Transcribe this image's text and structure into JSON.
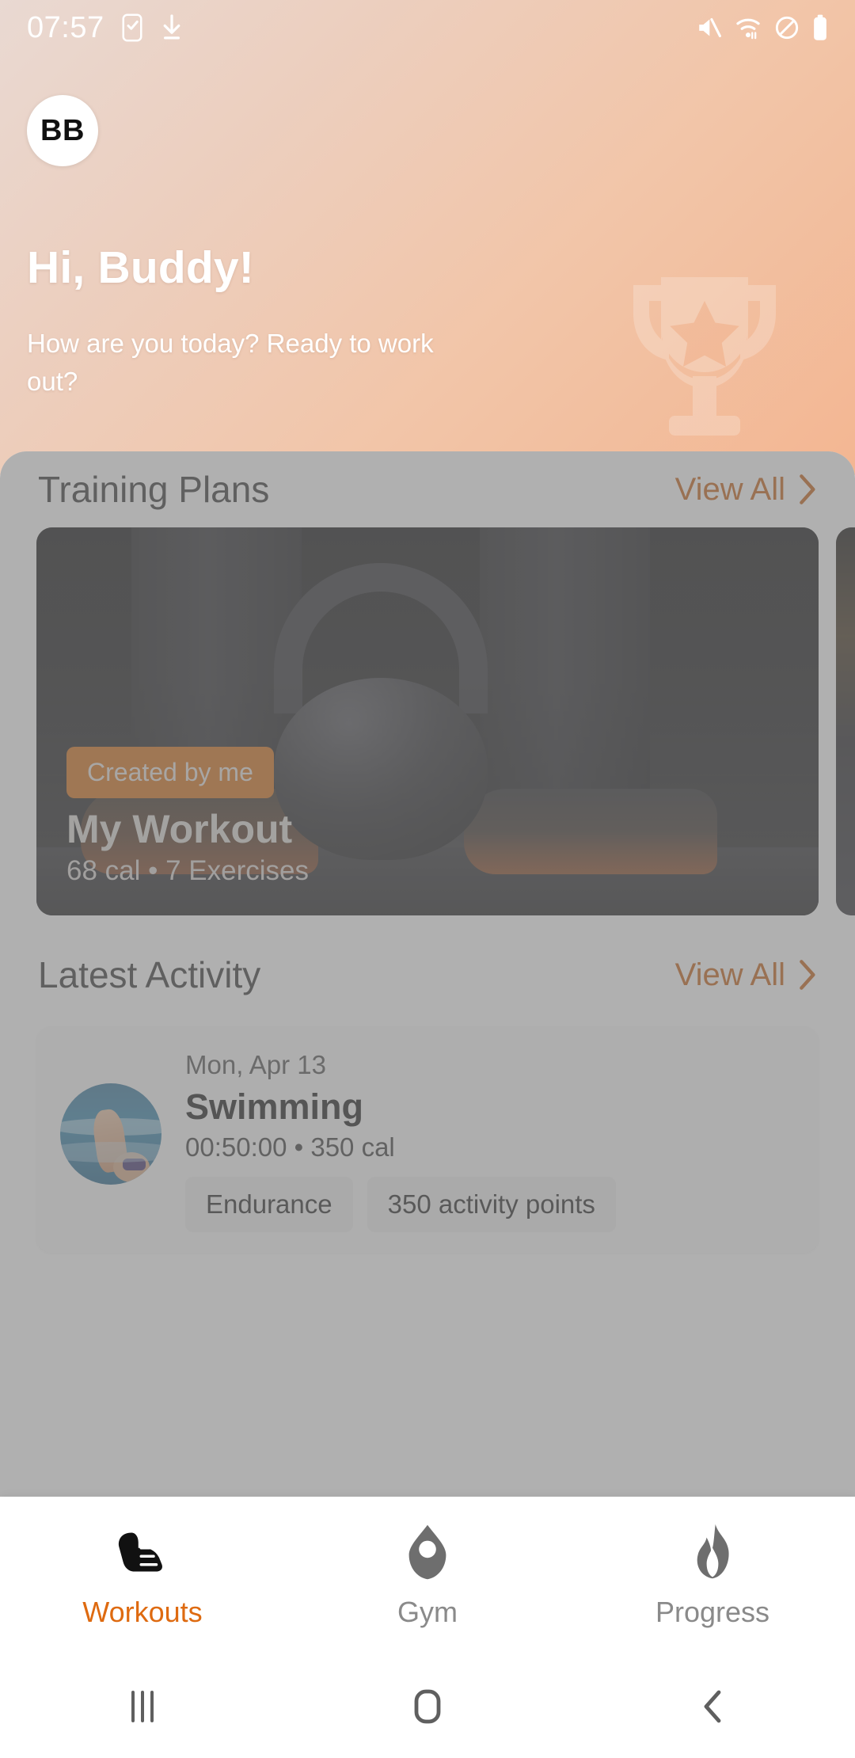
{
  "status_bar": {
    "time": "07:57",
    "left_icons": [
      "note-checklist-icon",
      "download-icon"
    ],
    "right_icons": [
      "mute-icon",
      "wifi-icon",
      "do-not-disturb-icon",
      "battery-icon"
    ]
  },
  "header": {
    "avatar_initials": "BB",
    "greeting": "Hi, Buddy!",
    "subgreeting": "How are you today? Ready to work out?",
    "watermark_icon": "trophy-icon",
    "gradient_from": "#e9d9d2",
    "gradient_to": "#f3b692"
  },
  "training_plans": {
    "section_title": "Training Plans",
    "view_all_label": "View All",
    "cards": [
      {
        "badge": "Created by me",
        "title": "My Workout",
        "subtitle": "68 cal • 7 Exercises",
        "image_alt": "kettlebell-photo"
      },
      {
        "badge": "",
        "title": "",
        "subtitle": "",
        "image_alt": "gym-photo"
      }
    ]
  },
  "latest_activity": {
    "section_title": "Latest Activity",
    "view_all_label": "View All",
    "items": [
      {
        "date": "Mon, Apr 13",
        "title": "Swimming",
        "stats": "00:50:00 • 350 cal",
        "thumb_alt": "swimmer-photo",
        "chips": [
          "Endurance",
          "350 activity points"
        ]
      }
    ]
  },
  "bottom_nav": {
    "items": [
      {
        "label": "Workouts",
        "icon": "shoe-icon",
        "active": true
      },
      {
        "label": "Gym",
        "icon": "gym-marker-icon",
        "active": false
      },
      {
        "label": "Progress",
        "icon": "flame-icon",
        "active": false
      }
    ],
    "active_color": "#de6a10",
    "inactive_color": "#8a8a8a"
  },
  "system_nav": {
    "buttons": [
      "recents-icon",
      "home-icon",
      "back-icon"
    ]
  },
  "theme": {
    "accent": "#d2690f",
    "link": "#c2590d",
    "scrim": "rgba(128,128,128,0.62)"
  }
}
